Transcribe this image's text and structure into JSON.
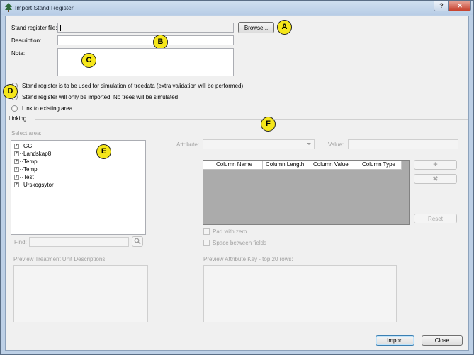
{
  "window": {
    "title": "Import Stand Register",
    "help_label": "?",
    "close_label": "✕"
  },
  "form": {
    "stand_register_label": "Stand register file:",
    "stand_register_value": "",
    "browse_label": "Browse...",
    "description_label": "Description:",
    "description_value": "",
    "note_label": "Note:",
    "note_value": ""
  },
  "options": {
    "radio1": "Stand register is to be used for simulation of treedata (extra validation will be performed)",
    "radio2": "Stand register will only be imported. No trees will be simulated",
    "radio3": "Link to existing area"
  },
  "linking": {
    "title": "Linking",
    "select_area_label": "Select area:",
    "tree_items": [
      "GG",
      "Landskap8",
      "Temp",
      "Temp",
      "Test",
      "Urskogsytor"
    ],
    "find_label": "Find:",
    "find_value": "",
    "attribute_label": "Attribute:",
    "attribute_value": "",
    "value_label": "Value:",
    "value_value": "",
    "columns": [
      "Column Name",
      "Column Length",
      "Column Value",
      "Column Type"
    ],
    "add_icon": "+",
    "remove_icon": "✖",
    "reset_label": "Reset",
    "pad_label": "Pad with zero",
    "space_label": "Space between fields",
    "preview_treatment_label": "Preview Treatment Unit Descriptions:",
    "preview_attribute_label": "Preview Attribute Key - top 20 rows:"
  },
  "footer": {
    "import_label": "Import",
    "close_label": "Close"
  },
  "callouts": [
    "A",
    "B",
    "C",
    "D",
    "E",
    "F"
  ]
}
